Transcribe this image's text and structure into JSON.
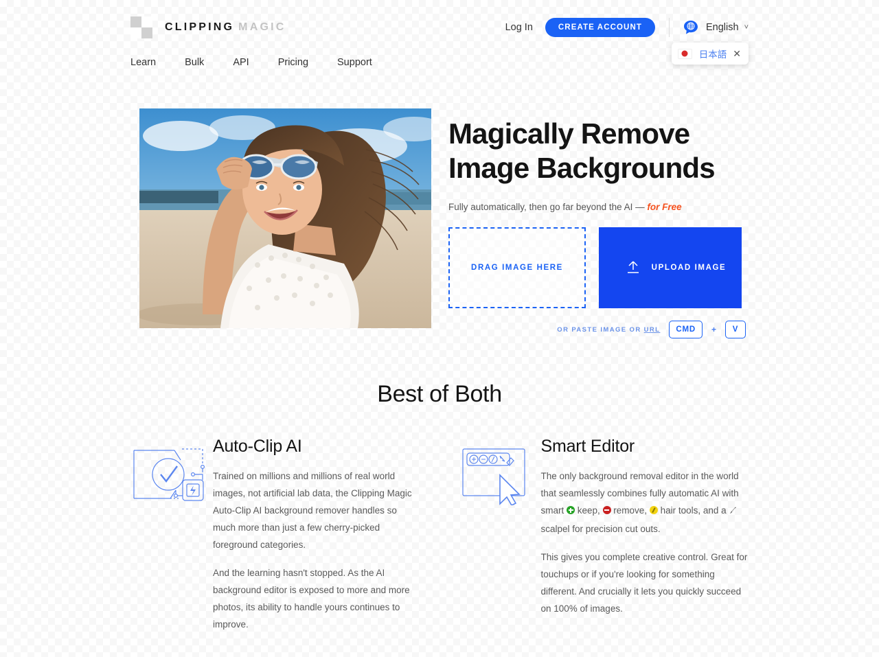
{
  "header": {
    "logo": {
      "primary": "CLIPPING",
      "secondary": "MAGIC",
      "icon": "checkerboard-logo-icon"
    },
    "nav": [
      {
        "label": "Learn"
      },
      {
        "label": "Bulk"
      },
      {
        "label": "API"
      },
      {
        "label": "Pricing"
      },
      {
        "label": "Support"
      }
    ],
    "login_label": "Log In",
    "create_account_label": "CREATE ACCOUNT",
    "language": {
      "current": "English",
      "globe_icon": "globe-speech-bubble-icon",
      "chevron": "˅"
    },
    "language_popup": {
      "flag": "japan-flag-icon",
      "label": "日本語",
      "close": "✕"
    }
  },
  "hero": {
    "photo_alt": "smiling-woman-beach-sunglasses-photo",
    "title_line1": "Magically Remove",
    "title_line2": "Image Backgrounds",
    "subtitle_prefix": "Fully automatically, then go far beyond the AI — ",
    "subtitle_free": "for Free",
    "dropzone_label": "DRAG IMAGE HERE",
    "upload_label": "UPLOAD IMAGE",
    "upload_icon": "upload-arrow-icon",
    "paste_prefix": "OR PASTE IMAGE OR ",
    "paste_url": "URL",
    "key_cmd": "CMD",
    "key_plus": "+",
    "key_v": "V"
  },
  "section": {
    "title": "Best of Both",
    "features": [
      {
        "icon": "auto-clip-ai-illustration-icon",
        "title": "Auto-Clip AI",
        "paragraph1": "Trained on millions and millions of real world images, not artificial lab data, the Clipping Magic Auto-Clip AI background remover handles so much more than just a few cherry-picked foreground categories.",
        "paragraph2": "And the learning hasn't stopped. As the AI background editor is exposed to more and more photos, its ability to handle yours continues to improve."
      },
      {
        "icon": "smart-editor-illustration-icon",
        "title": "Smart Editor",
        "p2_part1": "The only background removal editor in the world that seamlessly combines fully automatic AI with smart ",
        "p2_keep": " keep, ",
        "p2_remove": " remove, ",
        "p2_hair": " hair tools, and a ",
        "p2_scalpel": " scalpel for precision cut outs.",
        "paragraph2": "This gives you complete creative control. Great for touchups or if you're looking for something different. And crucially it lets you quickly succeed on 100% of images."
      }
    ]
  },
  "colors": {
    "brand_blue": "#1a62f5",
    "upload_blue": "#1446f0",
    "accent_orange": "#f5511e",
    "keep_green": "#27a327",
    "remove_red": "#c92020",
    "hair_yellow": "#f2d312"
  }
}
